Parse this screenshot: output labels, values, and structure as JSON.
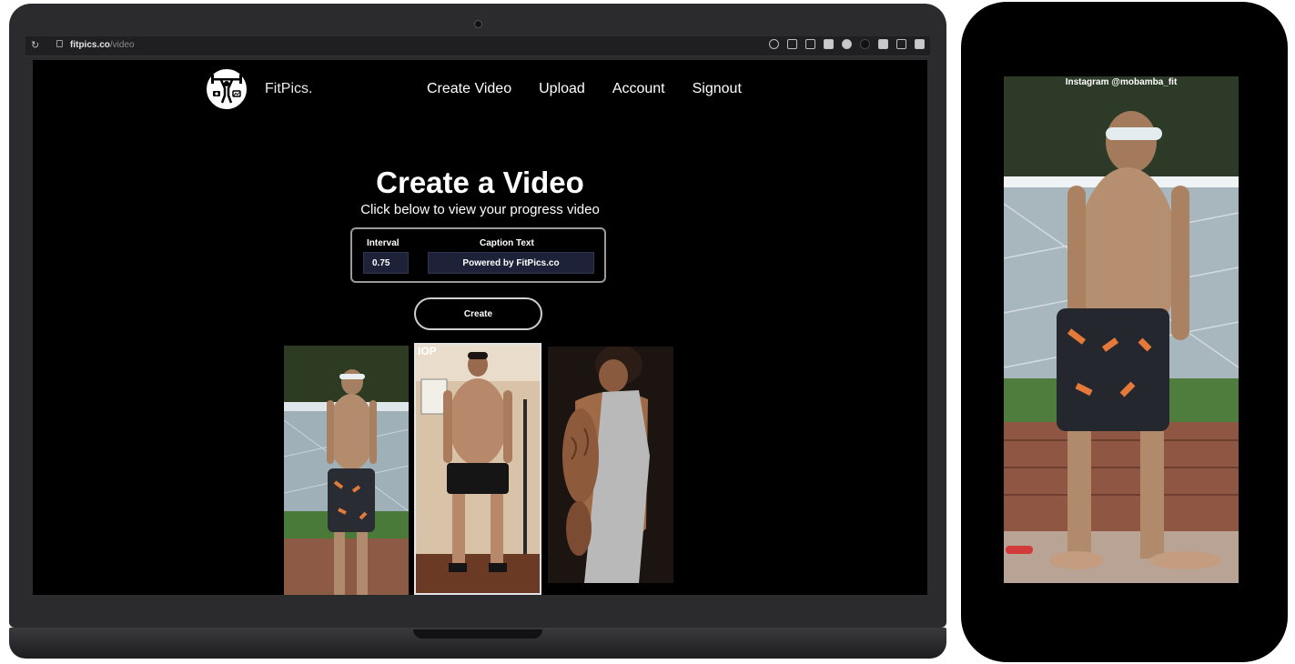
{
  "browser": {
    "url_host": "fitpics.co",
    "url_path": "/video"
  },
  "site": {
    "brand": "FitPics.",
    "nav": [
      "Create Video",
      "Upload",
      "Account",
      "Signout"
    ]
  },
  "main": {
    "title": "Create a Video",
    "subtitle": "Click below to view your progress video",
    "form": {
      "interval_label": "Interval",
      "interval_value": "0.75",
      "caption_label": "Caption Text",
      "caption_value": "Powered by FitPics.co"
    },
    "create_button": "Create",
    "photos": [
      {
        "overlay_text": ""
      },
      {
        "overlay_text": "IOP"
      },
      {
        "overlay_text": ""
      }
    ]
  },
  "phone": {
    "caption": "Instagram @mobamba_fit"
  },
  "colors": {
    "page_background": "#000000",
    "input_background": "#1d2238",
    "text": "#ffffff"
  }
}
